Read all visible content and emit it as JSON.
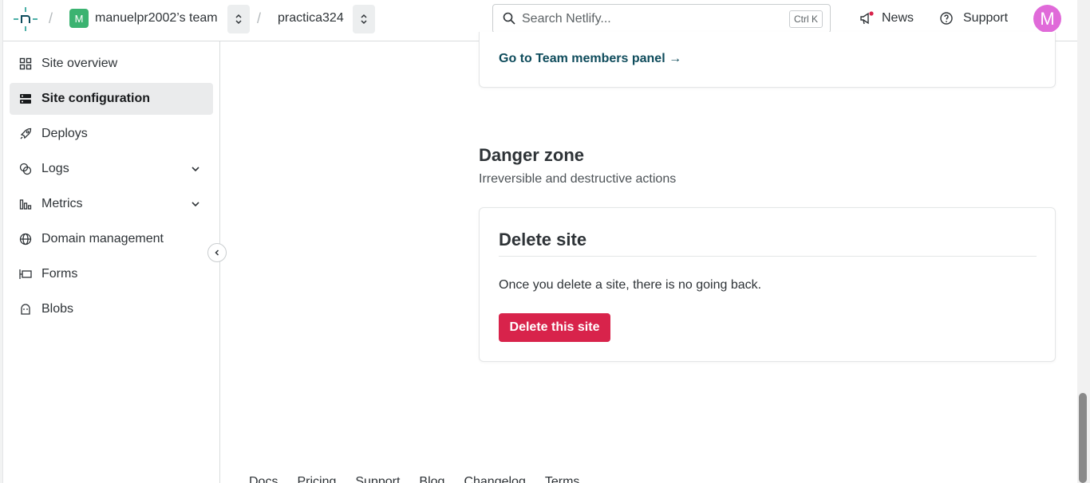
{
  "header": {
    "team_initial": "M",
    "team_name": "manuelpr2002’s team",
    "site_name": "practica324",
    "search_placeholder": "Search Netlify...",
    "search_shortcut": "Ctrl K",
    "news_label": "News",
    "support_label": "Support",
    "avatar_initial": "M"
  },
  "sidebar": {
    "items": [
      {
        "label": "Site overview",
        "icon": "grid-icon"
      },
      {
        "label": "Site configuration",
        "icon": "server-icon",
        "active": true
      },
      {
        "label": "Deploys",
        "icon": "rocket-icon"
      },
      {
        "label": "Logs",
        "icon": "layers-icon",
        "expandable": true
      },
      {
        "label": "Metrics",
        "icon": "bar-chart-icon",
        "expandable": true
      },
      {
        "label": "Domain management",
        "icon": "globe-icon"
      },
      {
        "label": "Forms",
        "icon": "form-icon"
      },
      {
        "label": "Blobs",
        "icon": "blob-icon"
      }
    ]
  },
  "main": {
    "team_members_link": "Go to Team members panel →",
    "danger_zone": {
      "title": "Danger zone",
      "subtitle": "Irreversible and destructive actions"
    },
    "delete_card": {
      "title": "Delete site",
      "text": "Once you delete a site, there is no going back.",
      "button_label": "Delete this site"
    }
  },
  "footer": {
    "links": [
      "Docs",
      "Pricing",
      "Support",
      "Blog",
      "Changelog",
      "Terms"
    ]
  },
  "colors": {
    "accent_teal": "#0f4c5c",
    "danger": "#d8234b",
    "team_badge": "#3bb371",
    "avatar": "#e06ad9"
  }
}
